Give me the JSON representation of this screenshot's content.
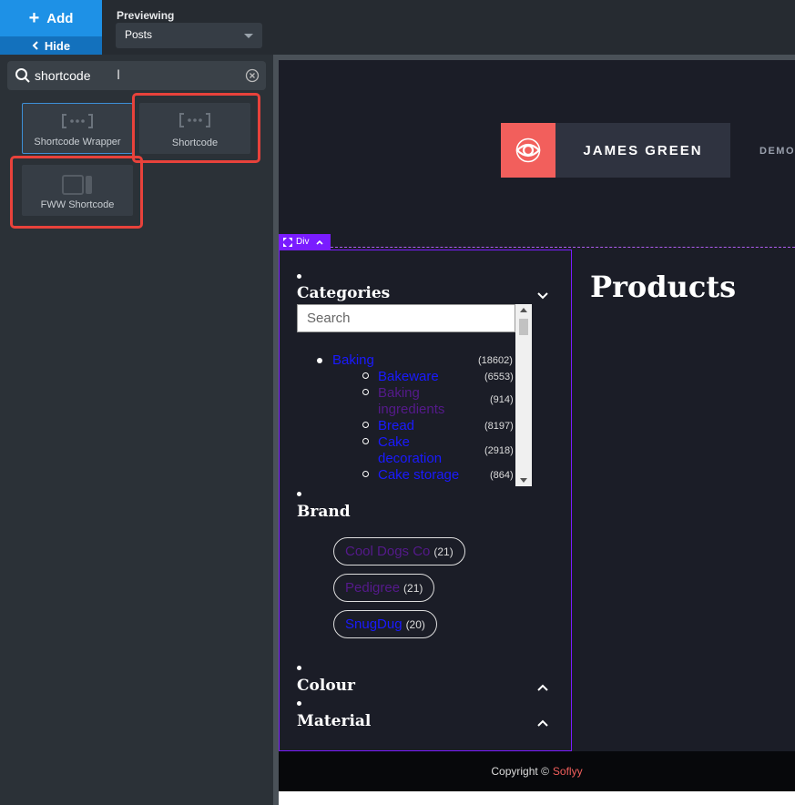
{
  "topbar": {
    "add_label": "Add",
    "hide_label": "Hide",
    "previewing_label": "Previewing",
    "previewing_value": "Posts"
  },
  "search": {
    "value": "shortcode"
  },
  "widgets": [
    {
      "label": "Shortcode Wrapper",
      "icon": "shortcode-icon"
    },
    {
      "label": "Shortcode",
      "icon": "shortcode-icon"
    },
    {
      "label": "FWW Shortcode",
      "icon": "fww-shortcode-icon"
    }
  ],
  "preview": {
    "brand_name": "JAMES GREEN",
    "nav_demo": "DEMO",
    "div_tag": "Div",
    "products_title": "Products",
    "footer": {
      "copyright": "Copyright ©",
      "brand": "Soflyy"
    },
    "colors": {
      "accent": "#f25f5c",
      "builder_purple": "#7a1cff",
      "link": "#1a1aff",
      "visited": "#551a8b"
    }
  },
  "categories": {
    "title": "Categories",
    "search_placeholder": "Search",
    "items": [
      {
        "name": "Baking",
        "count": "(18602)",
        "level": 0
      },
      {
        "name": "Bakeware",
        "count": "(6553)",
        "level": 1
      },
      {
        "name": "Baking ingredients",
        "count": "(914)",
        "level": 1
      },
      {
        "name": "Bread",
        "count": "(8197)",
        "level": 1
      },
      {
        "name": "Cake decoration",
        "count": "(2918)",
        "level": 1
      },
      {
        "name": "Cake storage",
        "count": "(864)",
        "level": 1
      }
    ]
  },
  "brand_filter": {
    "title": "Brand",
    "items": [
      {
        "name": "Cool Dogs Co",
        "count": "(21)"
      },
      {
        "name": "Pedigree",
        "count": "(21)"
      },
      {
        "name": "SnugDug",
        "count": "(20)"
      }
    ]
  },
  "colour_filter": {
    "title": "Colour"
  },
  "material_filter": {
    "title": "Material"
  }
}
